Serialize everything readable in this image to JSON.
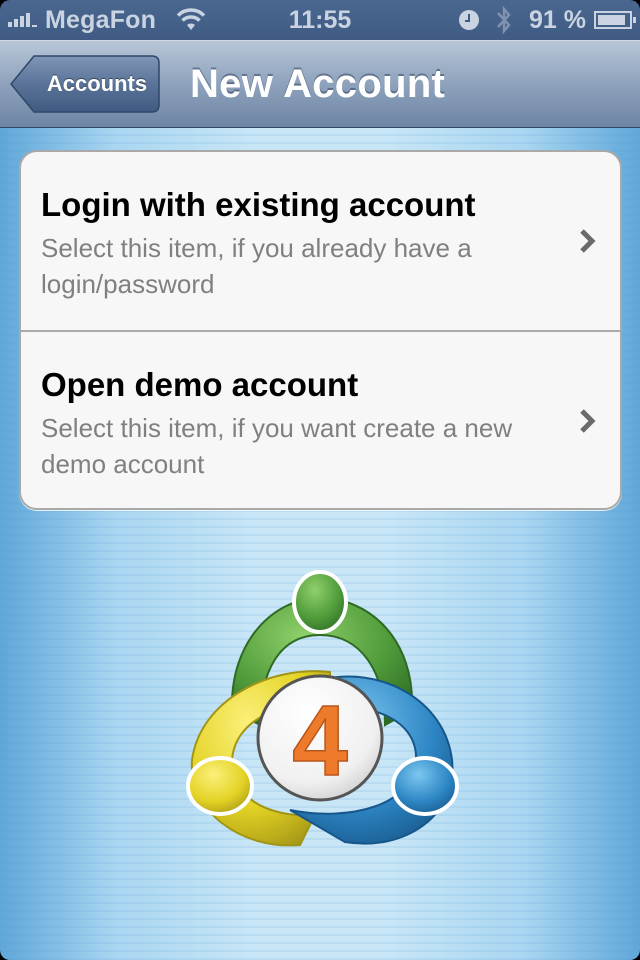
{
  "status_bar": {
    "carrier": "MegaFon",
    "time": "11:55",
    "battery_percent_label": "91 %",
    "battery_level": 0.91,
    "icons": [
      "signal-bars-icon",
      "wifi-icon",
      "alarm-clock-icon",
      "bluetooth-icon",
      "battery-icon"
    ]
  },
  "nav_bar": {
    "back_label": "Accounts",
    "title": "New Account"
  },
  "options": [
    {
      "title": "Login with existing account",
      "subtitle": "Select this item, if you already have a login/password",
      "accessory": "chevron-right-icon"
    },
    {
      "title": "Open demo account",
      "subtitle": "Select this item, if you want create a new demo account",
      "accessory": "chevron-right-icon"
    }
  ],
  "logo": {
    "label": "4",
    "name": "metatrader-4-logo",
    "colors": {
      "green": "#4f9a3a",
      "yellow": "#e3d224",
      "blue": "#2d86c4",
      "orange": "#ee7a2c"
    }
  }
}
